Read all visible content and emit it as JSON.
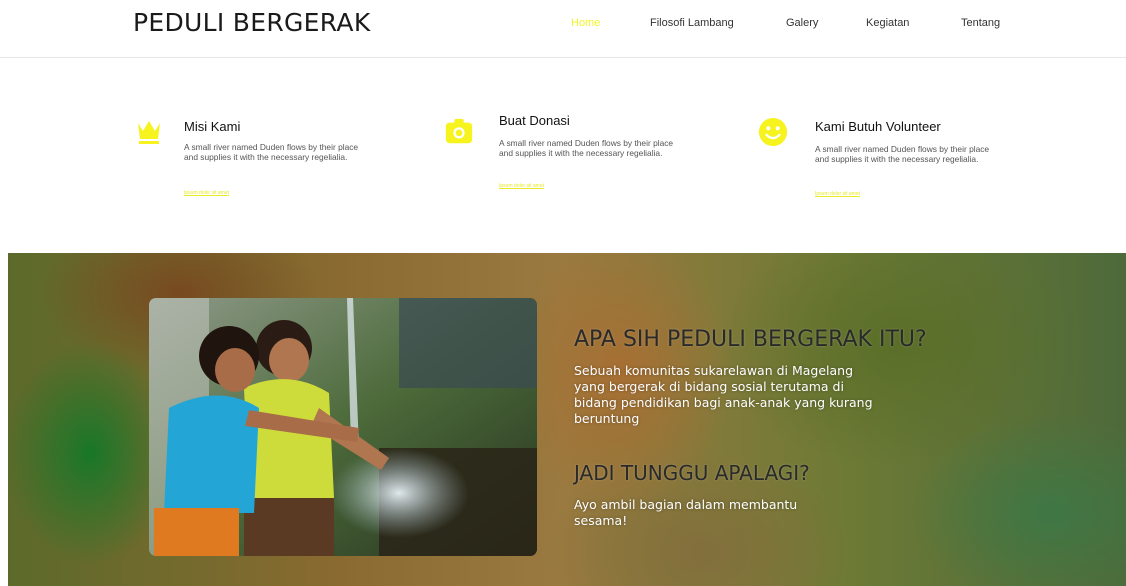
{
  "header": {
    "brand": "PEDULI BERGERAK",
    "nav": [
      {
        "label": "Home"
      },
      {
        "label": "Filosofi Lambang"
      },
      {
        "label": "Galery"
      },
      {
        "label": "Kegiatan"
      },
      {
        "label": "Tentang"
      }
    ]
  },
  "features": [
    {
      "title": "Misi Kami",
      "icon": "crown-icon",
      "text": "A small river named Duden flows by their place and supplies it with the necessary regelialia.",
      "link": "Ipsum dolor sit amet"
    },
    {
      "title": "Buat Donasi",
      "icon": "camera-icon",
      "text": "A small river named Duden flows by their place and supplies it with the necessary regelialia.",
      "link": "Ipsum dolor sit amet"
    },
    {
      "title": "Kami Butuh Volunteer",
      "icon": "smiley-icon",
      "text": "A small river named Duden flows by their place and supplies it with the necessary regelialia.",
      "link": "Ipsum dolor sit amet"
    }
  ],
  "hero": {
    "heading1": "APA SIH PEDULI BERGERAK ITU?",
    "paragraph1": "Sebuah komunitas sukarelawan di Magelang yang bergerak di bidang sosial terutama di bidang pendidikan bagi anak-anak yang kurang beruntung",
    "heading2": "JADI TUNGGU APALAGI?",
    "paragraph2": "Ayo ambil bagian dalam membantu sesama!"
  },
  "colors": {
    "accent": "#f3f52a",
    "heading": "#2a2a2a",
    "text": "#555555"
  }
}
